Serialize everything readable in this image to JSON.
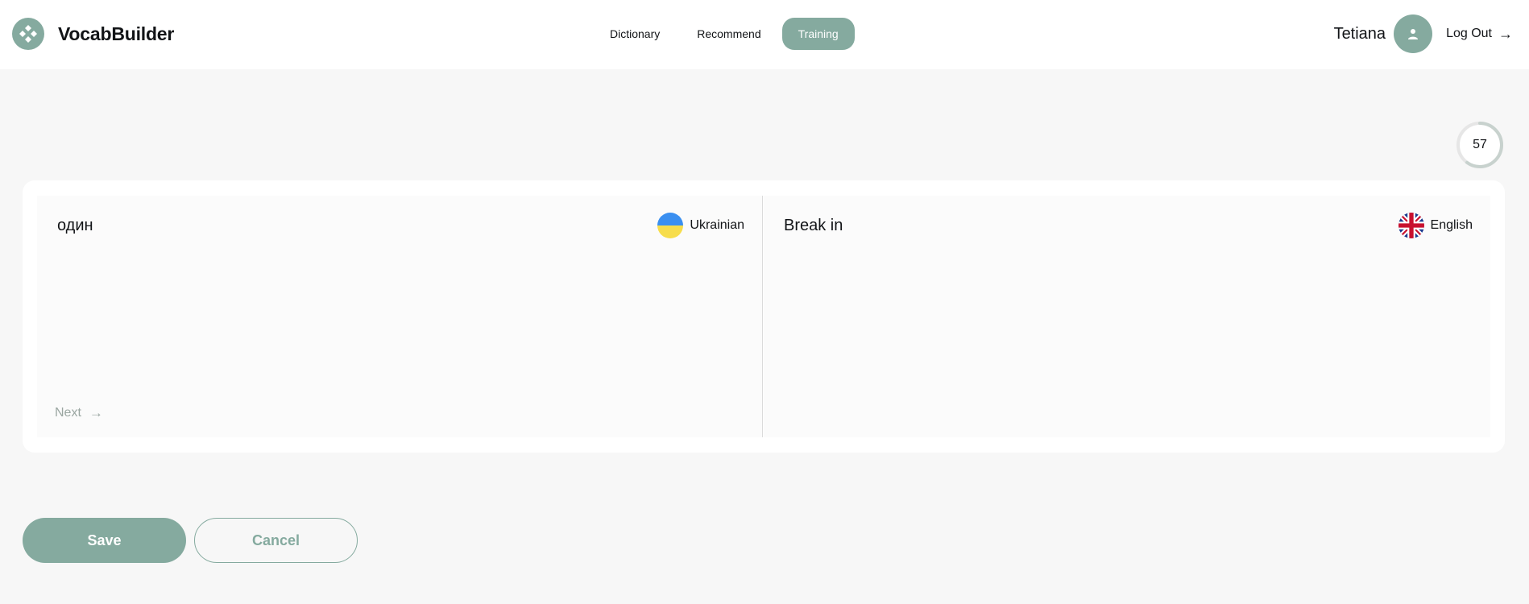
{
  "app": {
    "name": "VocabBuilder"
  },
  "nav": {
    "items": [
      {
        "label": "Dictionary",
        "active": false
      },
      {
        "label": "Recommend",
        "active": false
      },
      {
        "label": "Training",
        "active": true
      }
    ]
  },
  "user": {
    "name": "Tetiana",
    "logout_label": "Log Out",
    "logout_icon": "arrow-right-icon",
    "avatar_icon": "user-icon"
  },
  "progress": {
    "value": "57",
    "fraction": 0.6
  },
  "training": {
    "source": {
      "word": "один",
      "language": "Ukrainian",
      "flag_icon": "ukraine-flag-icon"
    },
    "target": {
      "word": "Break in",
      "language": "English",
      "flag_icon": "uk-flag-icon"
    },
    "next_label": "Next",
    "next_icon": "arrow-right-icon"
  },
  "actions": {
    "save_label": "Save",
    "cancel_label": "Cancel"
  },
  "colors": {
    "accent": "#85aa9f",
    "background": "#f7f7f7",
    "text": "#121417",
    "muted": "#9aa6a1",
    "flag_blue": "#3a8ff0",
    "flag_yellow": "#f7dd4b"
  }
}
